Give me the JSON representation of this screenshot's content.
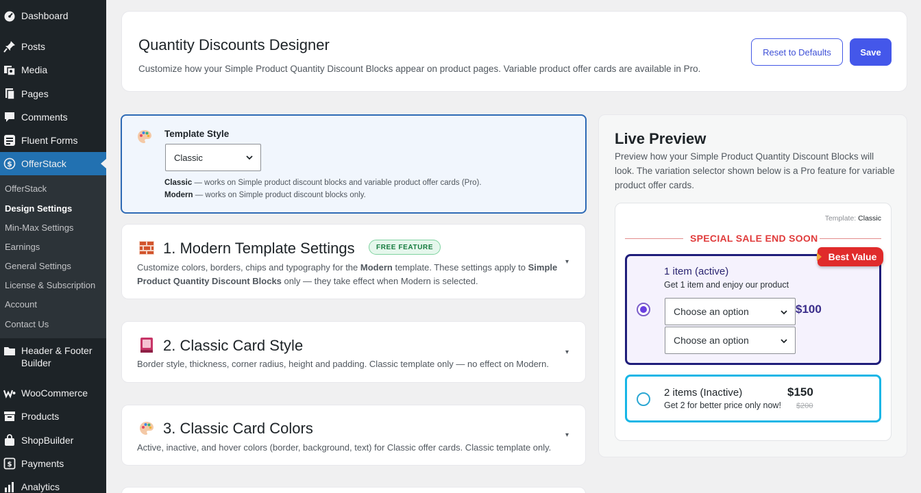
{
  "sidebar": {
    "items": [
      {
        "label": "Dashboard",
        "icon": "dashboard-icon"
      },
      {
        "label": "Posts",
        "icon": "pin-icon"
      },
      {
        "label": "Media",
        "icon": "media-icon"
      },
      {
        "label": "Pages",
        "icon": "pages-icon"
      },
      {
        "label": "Comments",
        "icon": "comment-icon"
      },
      {
        "label": "Fluent Forms",
        "icon": "forms-icon"
      },
      {
        "label": "OfferStack",
        "icon": "dollar-icon"
      }
    ],
    "submenu": [
      {
        "label": "OfferStack"
      },
      {
        "label": "Design Settings"
      },
      {
        "label": "Min-Max Settings"
      },
      {
        "label": "Earnings"
      },
      {
        "label": "General Settings"
      },
      {
        "label": "License & Subscription"
      },
      {
        "label": "Account"
      },
      {
        "label": "Contact Us"
      }
    ],
    "items_after": [
      {
        "label": "Header & Footer",
        "label2": "Builder",
        "icon": "folder-icon"
      },
      {
        "label": "WooCommerce",
        "icon": "woo-icon"
      },
      {
        "label": "Products",
        "icon": "archive-icon"
      },
      {
        "label": "ShopBuilder",
        "icon": "bag-icon"
      },
      {
        "label": "Payments",
        "icon": "payments-icon"
      },
      {
        "label": "Analytics",
        "icon": "chart-icon"
      }
    ]
  },
  "header": {
    "title": "Quantity Discounts Designer",
    "description": "Customize how your Simple Product Quantity Discount Blocks appear on product pages. Variable product offer cards are available in Pro.",
    "reset_label": "Reset to Defaults",
    "save_label": "Save"
  },
  "template_style": {
    "label": "Template Style",
    "selected": "Classic",
    "note1_bold": "Classic",
    "note1_rest": " — works on Simple product discount blocks and variable product offer cards (Pro).",
    "note2_bold": "Modern",
    "note2_rest": " — works on Simple product discount blocks only."
  },
  "sections": {
    "s1": {
      "title": "1. Modern Template Settings",
      "badge": "FREE FEATURE",
      "desc_a": "Customize colors, borders, chips and typography for the ",
      "desc_b": "Modern",
      "desc_c": " template. These settings apply to ",
      "desc_d": "Simple Product Quantity Discount Blocks",
      "desc_e": " only — they take effect when Modern is selected."
    },
    "s2": {
      "title": "2. Classic Card Style",
      "desc": "Border style, thickness, corner radius, height and padding. Classic template only — no effect on Modern."
    },
    "s3": {
      "title": "3. Classic Card Colors",
      "desc": "Active, inactive, and hover colors (border, background, text) for Classic offer cards. Classic template only."
    },
    "caret": "▾"
  },
  "preview": {
    "title": "Live Preview",
    "description": "Preview how your Simple Product Quantity Discount Blocks will look. The variation selector shown below is a Pro feature for variable product offer cards.",
    "template_label": "Template:",
    "template_value": "Classic",
    "sale_text": "SPECIAL SALE END SOON",
    "best_value": "Best Value",
    "offers": [
      {
        "title": "1 item (active)",
        "subtitle": "Get 1 item and enjoy our product",
        "price": "$100",
        "select1": "Choose an option",
        "select2": "Choose an option",
        "selected": true
      },
      {
        "title": "2 items (Inactive)",
        "subtitle": "Get 2 for better price only now!",
        "price": "$150",
        "old_price": "$200",
        "selected": false
      }
    ]
  },
  "colors": {
    "sidebar_bg": "#1d2327",
    "active_nav": "#2271b1",
    "primary_button": "#4457ea",
    "active_offer_border": "#1f1d7a",
    "inactive_offer_border": "#17b6e6",
    "sale_red": "#e03b3b"
  }
}
